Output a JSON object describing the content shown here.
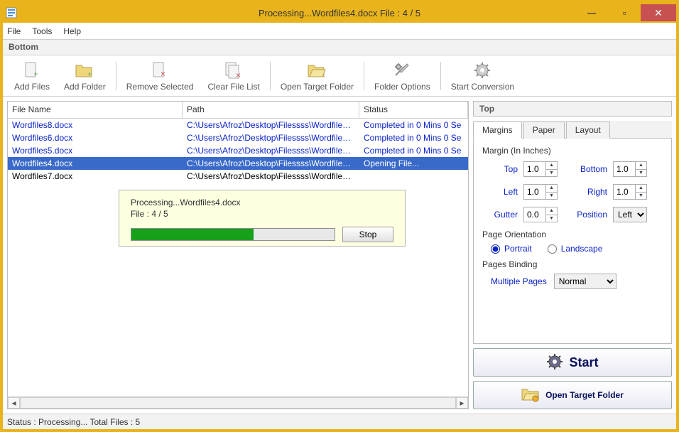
{
  "window": {
    "title": "Processing...Wordfiles4.docx File : 4 / 5"
  },
  "menu": {
    "file": "File",
    "tools": "Tools",
    "help": "Help"
  },
  "section_bottom": "Bottom",
  "section_top": "Top",
  "toolbar": {
    "add_files": "Add Files",
    "add_folder": "Add Folder",
    "remove_selected": "Remove Selected",
    "clear_file_list": "Clear File List",
    "open_target_folder": "Open Target Folder",
    "folder_options": "Folder Options",
    "start_conversion": "Start Conversion"
  },
  "grid": {
    "headers": {
      "name": "File Name",
      "path": "Path",
      "status": "Status"
    },
    "rows": [
      {
        "name": "Wordfiles8.docx",
        "path": "C:\\Users\\Afroz\\Desktop\\Filessss\\Wordfiles8...",
        "status": "Completed in 0 Mins 0 Se",
        "link": true,
        "sel": false
      },
      {
        "name": "Wordfiles6.docx",
        "path": "C:\\Users\\Afroz\\Desktop\\Filessss\\Wordfiles6...",
        "status": "Completed in 0 Mins 0 Se",
        "link": true,
        "sel": false
      },
      {
        "name": "Wordfiles5.docx",
        "path": "C:\\Users\\Afroz\\Desktop\\Filessss\\Wordfiles5...",
        "status": "Completed in 0 Mins 0 Se",
        "link": true,
        "sel": false
      },
      {
        "name": "Wordfiles4.docx",
        "path": "C:\\Users\\Afroz\\Desktop\\Filessss\\Wordfiles4...",
        "status": "Opening File...",
        "link": true,
        "sel": true
      },
      {
        "name": "Wordfiles7.docx",
        "path": "C:\\Users\\Afroz\\Desktop\\Filessss\\Wordfiles7...",
        "status": "",
        "link": false,
        "sel": false
      }
    ]
  },
  "popup": {
    "line1": "Processing...Wordfiles4.docx",
    "line2": "File : 4 / 5",
    "stop": "Stop",
    "progress_pct": 60
  },
  "tabs": {
    "margins": "Margins",
    "paper": "Paper",
    "layout": "Layout"
  },
  "margins_panel": {
    "group": "Margin (In Inches)",
    "top_lbl": "Top",
    "top_val": "1.0",
    "bottom_lbl": "Bottom",
    "bottom_val": "1.0",
    "left_lbl": "Left",
    "left_val": "1.0",
    "right_lbl": "Right",
    "right_val": "1.0",
    "gutter_lbl": "Gutter",
    "gutter_val": "0.0",
    "position_lbl": "Position",
    "position_val": "Left",
    "orientation_hdr": "Page Orientation",
    "portrait": "Portrait",
    "landscape": "Landscape",
    "binding_hdr": "Pages Binding",
    "multiple_pages_lbl": "Multiple Pages",
    "multiple_pages_val": "Normal"
  },
  "bigbuttons": {
    "start": "Start",
    "open_target": "Open Target Folder"
  },
  "statusbar": "Status  :  Processing...  Total Files : 5"
}
